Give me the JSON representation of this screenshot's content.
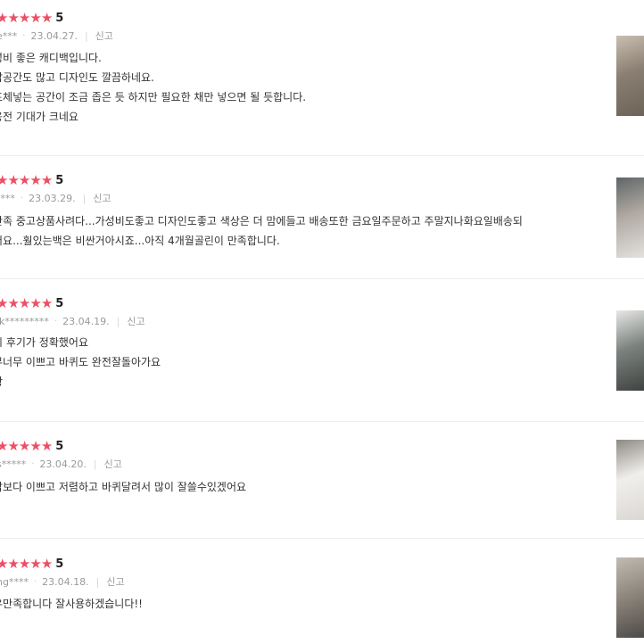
{
  "reviews": [
    {
      "rating": "5",
      "username": "e***",
      "date": "23.04.27.",
      "report_label": "신고",
      "lines": [
        "성비 좋은 캐디백입니다.",
        "납공간도 많고 디자인도 깔끔하네요.",
        "프체넣는 공간이 조금 좁은 듯 하지만 필요한 채만 넣으면 될 듯합니다.",
        "용전 기대가 크네요"
      ],
      "thumb_colors": [
        "#6b6257",
        "#c9bfb1",
        "#8a7f72"
      ]
    },
    {
      "rating": "5",
      "username": "!***",
      "date": "23.03.29.",
      "report_label": "신고",
      "lines": [
        "만족 중고상품사려다...가성비도좋고 디자인도좋고 색상은 더 맘에들고 배송또한 금요일주문하고 주말지나화요일배송되",
        "어요...훨있는백은 비싼거아시죠...아직 4개월골린이 만족합니다."
      ],
      "thumb_colors": [
        "#e6e4e2",
        "#5f6668",
        "#b0a9a2"
      ]
    },
    {
      "rating": "5",
      "username": "ik*********",
      "date": "23.04.19.",
      "report_label": "신고",
      "lines": [
        "시 후기가 정확했어요",
        "무너무 이쁘고 바퀴도 완전잘돌아가요",
        "광"
      ],
      "thumb_colors": [
        "#3c3f3d",
        "#e8e8e6",
        "#7c837f"
      ]
    },
    {
      "rating": "5",
      "username": "s*****",
      "date": "23.04.20.",
      "report_label": "신고",
      "lines": [
        "각보다 이쁘고 저렴하고 바퀴달려서 많이 잘쓸수있겠어요"
      ],
      "thumb_colors": [
        "#d9d6d2",
        "#8e8a85",
        "#f1efec"
      ]
    },
    {
      "rating": "5",
      "username": "ng****",
      "date": "23.04.18.",
      "report_label": "신고",
      "lines": [
        "우만족합니다 잘사용하겠습니다!!"
      ],
      "thumb_colors": [
        "#4a4744",
        "#c2bbb2",
        "#8f877d"
      ]
    }
  ]
}
